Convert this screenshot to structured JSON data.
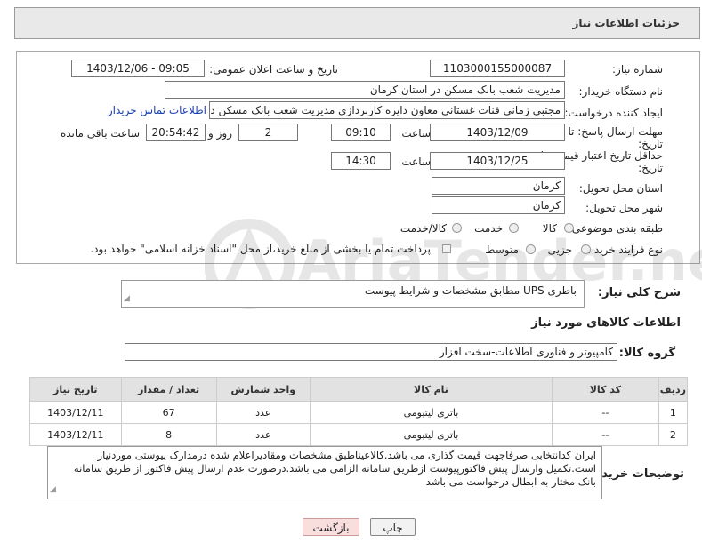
{
  "header": {
    "title": "جزئیات اطلاعات نیاز"
  },
  "form": {
    "need_number_label": "شماره نیاز:",
    "need_number": "1103000155000087",
    "announce_label": "تاریخ و ساعت اعلان عمومی:",
    "announce_value": "1403/12/06 - 09:05",
    "buyer_org_label": "نام دستگاه خریدار:",
    "buyer_org": "مدیریت شعب بانک مسکن در استان کرمان",
    "creator_label": "ایجاد کننده درخواست:",
    "creator": "مجتبی زمانی قنات غستانی معاون دایره کاربردازی مدیریت شعب بانک مسکن د",
    "contact_link": "اطلاعات تماس خریدار",
    "deadline_label_1": "مهلت ارسال پاسخ: تا",
    "deadline_label_2": "تاریخ:",
    "deadline_date": "1403/12/09",
    "time_label": "ساعت",
    "deadline_time": "09:10",
    "days_value": "2",
    "days_label": "روز و",
    "remaining_time": "20:54:42",
    "remaining_label": "ساعت باقی مانده",
    "validity_label_1": "حداقل تاریخ اعتبار قیمت: تا",
    "validity_label_2": "تاریخ:",
    "validity_date": "1403/12/25",
    "validity_time": "14:30",
    "delivery_province_label": "استان محل تحویل:",
    "delivery_province": "کرمان",
    "delivery_city_label": "شهر محل تحویل:",
    "delivery_city": "کرمان",
    "category_label": "طبقه بندی موضوعی:",
    "category_options": [
      "کالا",
      "خدمت",
      "کالا/خدمت"
    ],
    "process_label": "نوع فرآیند خرید :",
    "process_options": [
      "جزیی",
      "متوسط"
    ],
    "payment_note": "پرداخت تمام یا بخشی از مبلغ خرید،از محل \"اسناد خزانه اسلامی\" خواهد بود."
  },
  "summary": {
    "label": "شرح کلی نیاز:",
    "value": "باطری UPS مطابق مشخصات و شرایط پیوست"
  },
  "goods_section": {
    "title": "اطلاعات کالاهای مورد نیاز",
    "group_label": "گروه کالا:",
    "group_value": "کامپیوتر و فناوری اطلاعات-سخت افزار"
  },
  "table": {
    "headers": [
      "ردیف",
      "کد کالا",
      "نام کالا",
      "واحد شمارش",
      "تعداد / مقدار",
      "تاریخ نیاز"
    ],
    "rows": [
      [
        "1",
        "--",
        "باتری لیتیومی",
        "عدد",
        "67",
        "1403/12/11"
      ],
      [
        "2",
        "--",
        "باتری لیتیومی",
        "عدد",
        "8",
        "1403/12/11"
      ]
    ]
  },
  "buyer_notes": {
    "label": "توضیحات خریدار:",
    "text": "ایران کدانتخابی صرفاجهت قیمت گذاری می باشد.کالاعیناطبق مشخصات ومقادیراعلام شده درمدارک پیوستی موردنیاز است.تکمیل وارسال پیش فاکتورپیوست ازطریق سامانه الزامی می باشد.درصورت عدم ارسال پیش فاکتور از طریق سامانه بانک مختار به ابطال درخواست می باشد"
  },
  "buttons": {
    "print": "چاپ",
    "back": "بازگشت"
  },
  "watermark": "AriaTender.net",
  "colors": {
    "link": "#1a3fb3",
    "back_button_bg": "#f9dede",
    "header_bg": "#e9e9e9"
  }
}
